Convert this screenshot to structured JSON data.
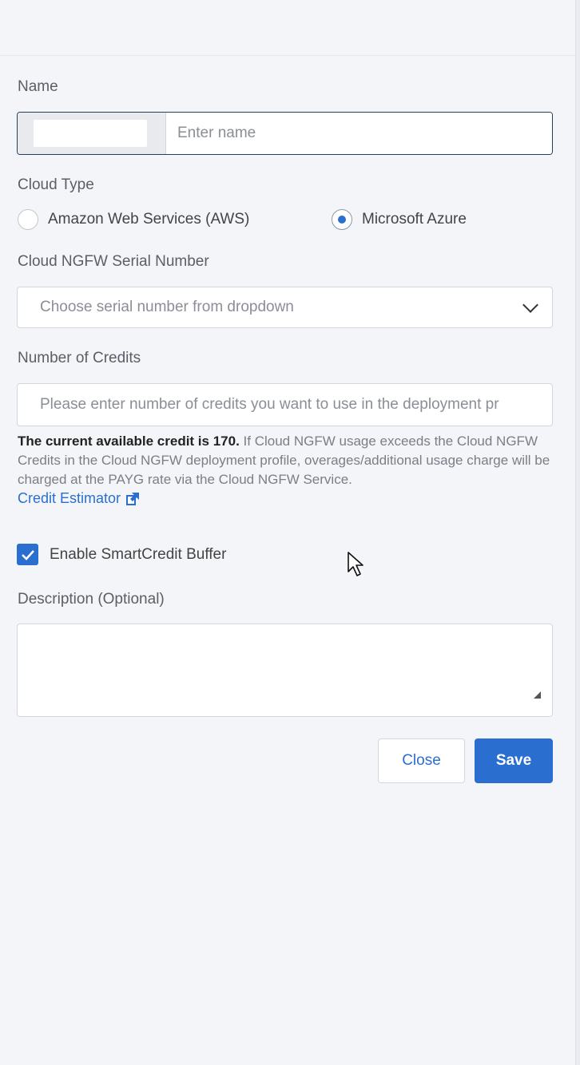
{
  "form": {
    "name_label": "Name",
    "name_placeholder": "Enter name",
    "cloud_type_label": "Cloud Type",
    "cloud_type_options": [
      {
        "label": "Amazon Web Services (AWS)",
        "selected": false
      },
      {
        "label": "Microsoft Azure",
        "selected": true
      }
    ],
    "serial_label": "Cloud NGFW Serial Number",
    "serial_placeholder": "Choose serial number from dropdown",
    "credits_label": "Number of Credits",
    "credits_placeholder": "Please enter number of credits you want to use in the deployment pr",
    "help_bold": "The current available credit is 170.",
    "help_text": " If Cloud NGFW usage exceeds the Cloud NGFW Credits in the Cloud NGFW deployment profile, overages/additional usage charge will be charged at the PAYG rate via the Cloud NGFW Service.",
    "credit_estimator_link": "Credit Estimator",
    "smartcredit_label": "Enable SmartCredit Buffer",
    "smartcredit_checked": true,
    "description_label": "Description (Optional)"
  },
  "buttons": {
    "close": "Close",
    "save": "Save"
  },
  "colors": {
    "accent": "#2a6fcf",
    "background": "#f4f5f9",
    "focus_border": "#2a3d58"
  },
  "icons": {
    "external_link": "external-link-icon",
    "dropdown": "chevron-down-icon",
    "checkbox": "check-icon"
  }
}
